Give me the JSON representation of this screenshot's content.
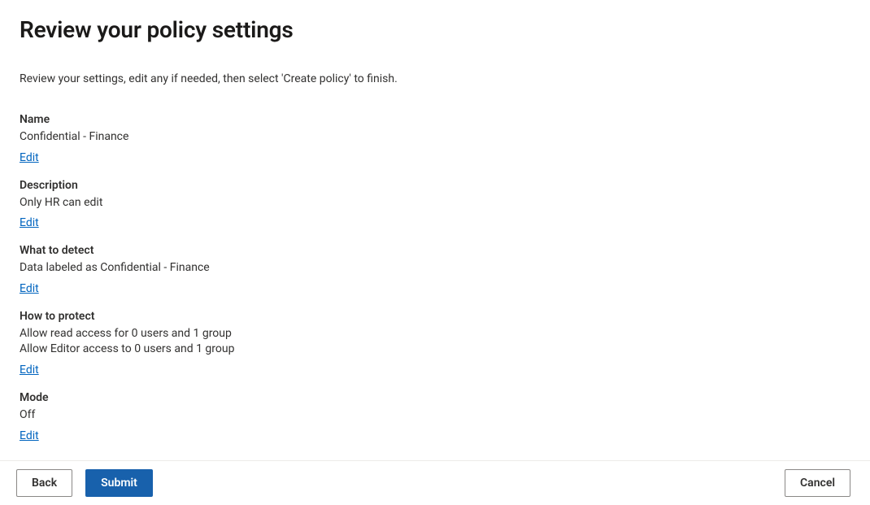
{
  "page": {
    "title": "Review your policy settings",
    "subtitle": "Review your settings, edit any if needed, then select 'Create policy' to finish."
  },
  "sections": {
    "name": {
      "label": "Name",
      "value": "Confidential - Finance",
      "edit": "Edit"
    },
    "description": {
      "label": "Description",
      "value": "Only HR can edit",
      "edit": "Edit"
    },
    "detect": {
      "label": "What to detect",
      "value": "Data labeled as Confidential - Finance",
      "edit": "Edit"
    },
    "protect": {
      "label": "How to protect",
      "line1": "Allow read access for 0 users and 1 group",
      "line2": "Allow Editor access to 0 users and 1 group",
      "edit": "Edit"
    },
    "mode": {
      "label": "Mode",
      "value": "Off",
      "edit": "Edit"
    }
  },
  "buttons": {
    "back": "Back",
    "submit": "Submit",
    "cancel": "Cancel"
  }
}
